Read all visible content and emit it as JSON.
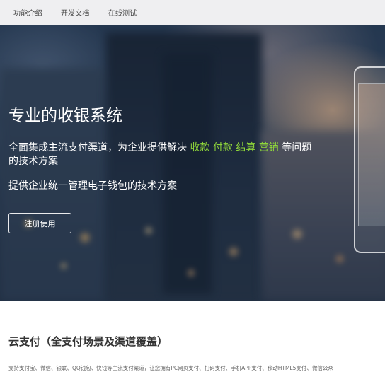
{
  "nav": {
    "items": [
      "功能介绍",
      "开发文档",
      "在线测试"
    ]
  },
  "hero": {
    "title": "专业的收银系统",
    "line1_prefix": "全面集成主流支付渠道，为企业提供解决",
    "highlights": [
      "收款",
      "付款",
      "结算",
      "营销"
    ],
    "line1_suffix": "等问题的技术方案",
    "line2": "提供企业统一管理电子钱包的技术方案",
    "register_button": "注册使用",
    "highlight_color": "#8fd63a"
  },
  "section": {
    "title": "云支付（全支付场景及渠道覆盖）",
    "description": "支持支付宝、微信、银联、QQ钱包、快钱等主流支付渠道，让您拥有PC网页支付、扫码支付、手机APP支付、移动HTML5支付、微信公众"
  }
}
